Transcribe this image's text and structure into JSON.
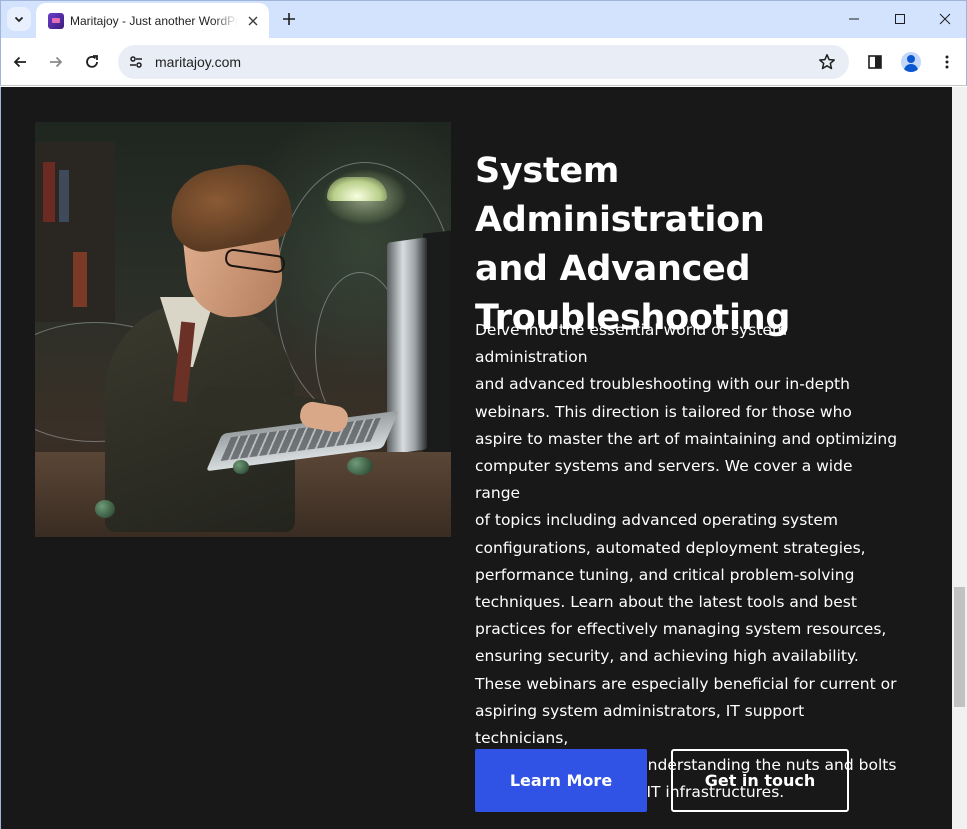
{
  "browser": {
    "tab_title": "Maritajoy - Just another WordPress site",
    "url": "maritajoy.com"
  },
  "hero": {
    "image_alt": "Illustration of a young man in glasses typing at a keyboard in a dimly lit room tangled with wires",
    "title_line1": "System Administration",
    "title_line2": "and Advanced",
    "title_line3": "Troubleshooting",
    "body_lines": [
      "Delve into the essential world of system administration",
      "and advanced troubleshooting with our in-depth",
      "webinars. This direction is tailored for those who",
      "aspire to master the art of maintaining and optimizing",
      "computer systems and servers. We cover a wide range",
      "of topics including advanced operating system",
      "configurations, automated deployment strategies,",
      "performance tuning, and critical problem-solving",
      "techniques. Learn about the latest tools and best",
      "practices for effectively managing system resources,",
      "ensuring security, and achieving high availability.",
      "These webinars are especially beneficial for current or",
      "aspiring system administrators, IT support technicians,",
      "and anyone keen on understanding the nuts and bolts",
      "of maintaining robust IT infrastructures."
    ],
    "primary_button": "Learn More",
    "secondary_button": "Get in touch"
  },
  "colors": {
    "page_background": "#181818",
    "primary_button": "#3052e5",
    "tabbar": "#d3e3fd"
  }
}
